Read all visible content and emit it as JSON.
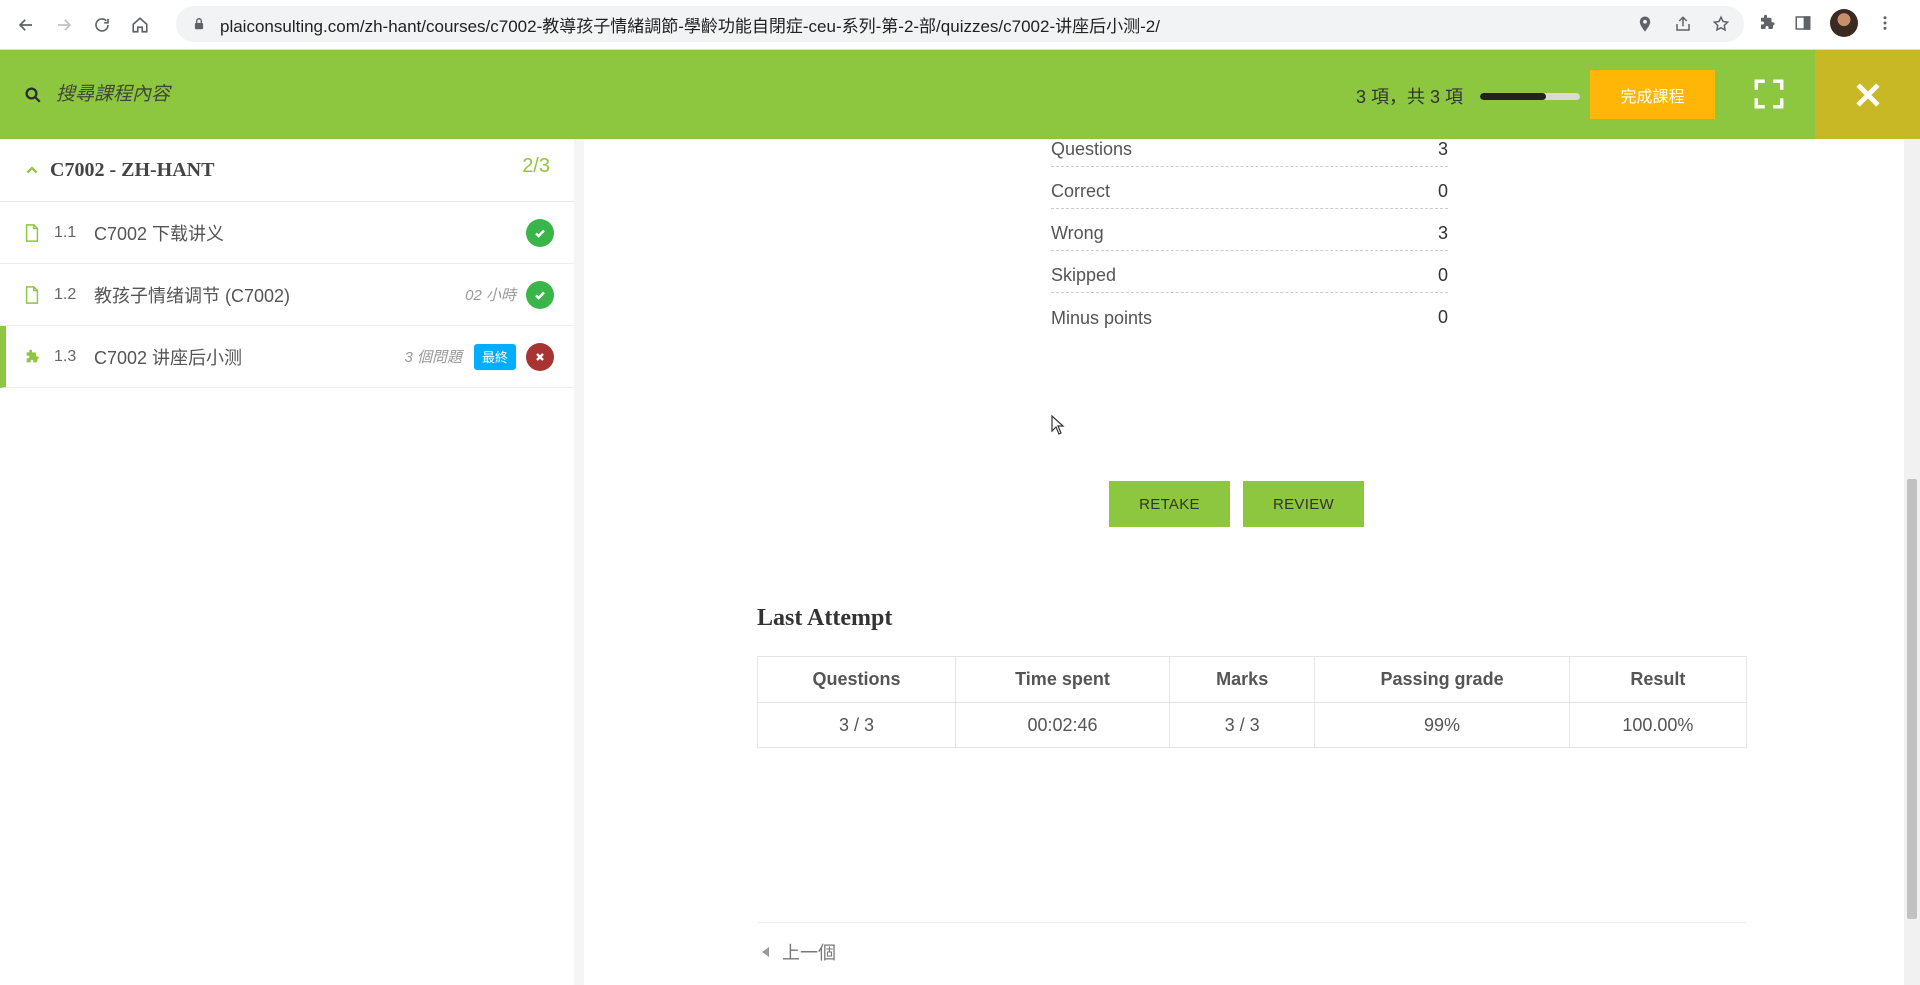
{
  "browser": {
    "url": "plaiconsulting.com/zh-hant/courses/c7002-教導孩子情緒調節-學齡功能自閉症-ceu-系列-第-2-部/quizzes/c7002-讲座后小测-2/"
  },
  "topbar": {
    "search_placeholder": "搜尋課程內容",
    "progress_text": "3 項，共 3 項",
    "progress_fraction": 0.66,
    "finish_label": "完成課程",
    "accent_color": "#8dc63f"
  },
  "sidebar": {
    "section_title": "C7002 - ZH-HANT",
    "section_count": "2/3",
    "lessons": [
      {
        "num": "1.1",
        "name": "C7002 下载讲义",
        "meta": "",
        "badge": "",
        "status": "pass",
        "icon": "document-icon"
      },
      {
        "num": "1.2",
        "name": "教孩子情绪调节 (C7002)",
        "meta": "02 小時",
        "badge": "",
        "status": "pass",
        "icon": "document-icon"
      },
      {
        "num": "1.3",
        "name": "C7002 讲座后小测",
        "meta": "3 個問題",
        "badge": "最終",
        "status": "fail",
        "icon": "puzzle-icon"
      }
    ]
  },
  "results": {
    "rows": [
      {
        "label": "Questions",
        "value": "3"
      },
      {
        "label": "Correct",
        "value": "0"
      },
      {
        "label": "Wrong",
        "value": "3"
      },
      {
        "label": "Skipped",
        "value": "0"
      },
      {
        "label": "Minus points",
        "value": "0"
      }
    ],
    "retake_label": "RETAKE",
    "review_label": "REVIEW"
  },
  "last_attempt": {
    "title": "Last Attempt",
    "headers": [
      "Questions",
      "Time spent",
      "Marks",
      "Passing grade",
      "Result"
    ],
    "values": [
      "3 / 3",
      "00:02:46",
      "3 / 3",
      "99%",
      "100.00%"
    ]
  },
  "footer": {
    "prev_label": "上一個"
  }
}
